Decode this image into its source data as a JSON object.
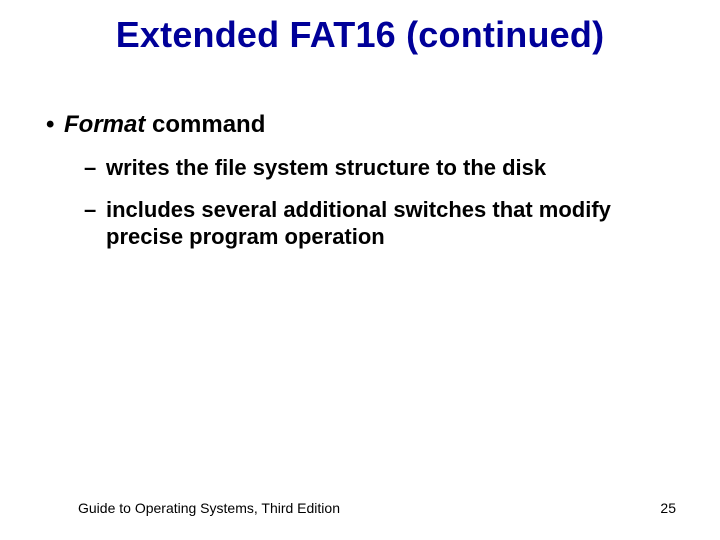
{
  "title": "Extended FAT16 (continued)",
  "bullet1": {
    "word_italic": "Format",
    "word_rest": " command"
  },
  "sub1": "writes the file system structure to the disk",
  "sub2": "includes several additional switches that modify precise program operation",
  "footer_left": "Guide to Operating Systems, Third Edition",
  "footer_right": "25"
}
